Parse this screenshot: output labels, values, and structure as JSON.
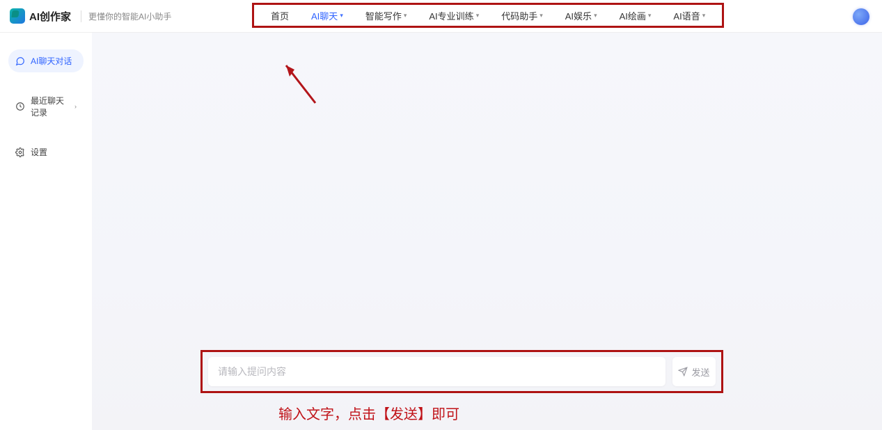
{
  "header": {
    "app_name": "AI创作家",
    "tagline": "更懂你的智能AI小助手"
  },
  "nav": {
    "items": [
      {
        "label": "首页",
        "has_dropdown": false
      },
      {
        "label": "AI聊天",
        "has_dropdown": true,
        "active": true
      },
      {
        "label": "智能写作",
        "has_dropdown": true
      },
      {
        "label": "AI专业训练",
        "has_dropdown": true
      },
      {
        "label": "代码助手",
        "has_dropdown": true
      },
      {
        "label": "AI娱乐",
        "has_dropdown": true
      },
      {
        "label": "AI绘画",
        "has_dropdown": true
      },
      {
        "label": "AI语音",
        "has_dropdown": true
      }
    ]
  },
  "sidebar": {
    "items": [
      {
        "label": "AI聊天对话",
        "icon": "chat-icon",
        "active": true
      },
      {
        "label": "最近聊天记录",
        "icon": "clock-icon",
        "chevron": true
      },
      {
        "label": "设置",
        "icon": "gear-icon"
      }
    ]
  },
  "chat": {
    "input_placeholder": "请输入提问内容",
    "send_label": "发送"
  },
  "annotations": {
    "caption": "输入文字，点击【发送】即可"
  },
  "colors": {
    "accent": "#2f63ff",
    "annotation": "#ae1313"
  }
}
